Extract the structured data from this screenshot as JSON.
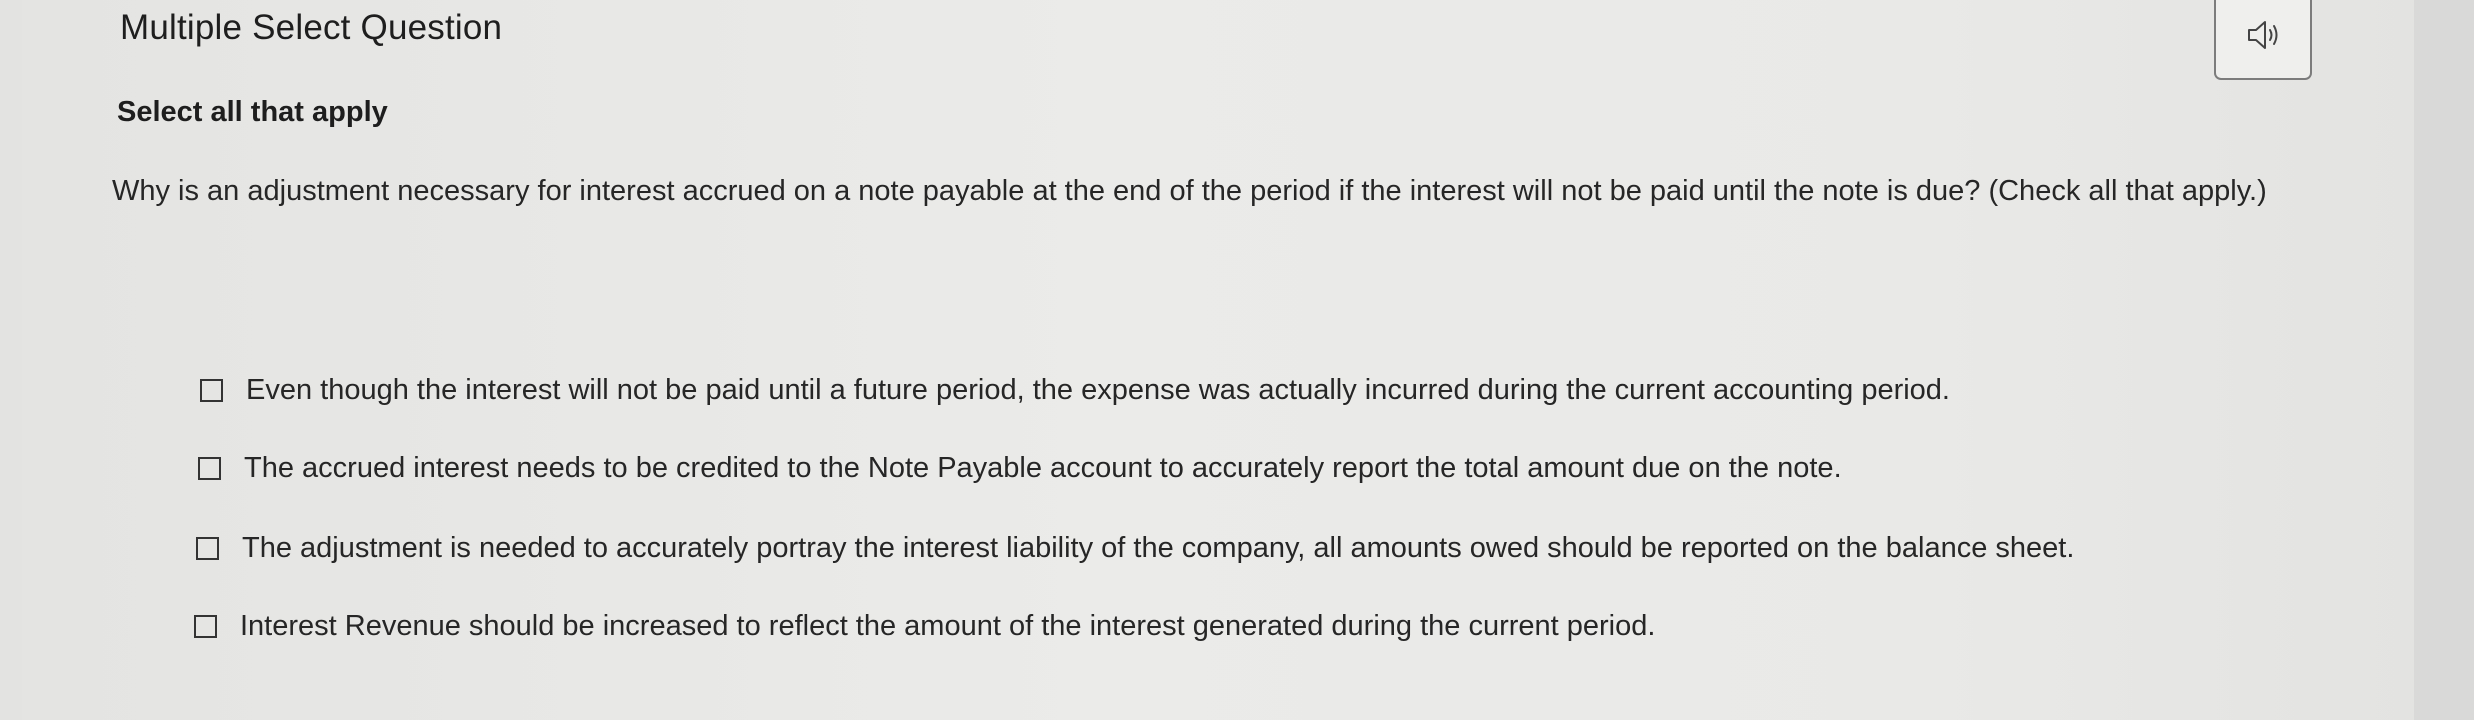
{
  "header": {
    "title": "Multiple Select Question"
  },
  "audio_button": {
    "icon": "speaker-icon"
  },
  "instruction": "Select all that apply",
  "question": {
    "prompt": "Why is an adjustment necessary for interest accrued on a note payable at the end of the period if the interest will not be paid until the note is due? (Check all that apply.)"
  },
  "options": [
    {
      "label": "Even though the interest will not be paid until a future period, the expense was actually incurred during the current accounting period.",
      "checked": false
    },
    {
      "label": "The accrued interest needs to be credited to the Note Payable account to accurately report the total amount due on the note.",
      "checked": false
    },
    {
      "label": "The adjustment is needed to accurately portray the interest liability of the company, all amounts owed should be reported on the balance sheet.",
      "checked": false
    },
    {
      "label": "Interest Revenue should be increased to reflect the amount of the interest generated during the current period.",
      "checked": false
    }
  ]
}
